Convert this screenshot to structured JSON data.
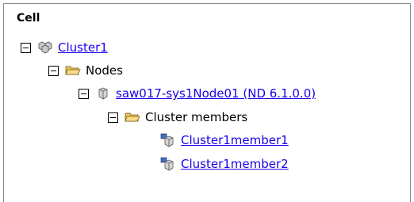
{
  "tree": {
    "root_label": "Cell",
    "cluster": {
      "label": "Cluster1",
      "icon": "cluster-icon"
    },
    "nodes": {
      "label": "Nodes",
      "icon": "folder-open-icon"
    },
    "node": {
      "label": "saw017-sys1Node01 (ND 6.1.0.0)",
      "icon": "server-node-icon"
    },
    "members_folder": {
      "label": "Cluster members",
      "icon": "folder-open-icon"
    },
    "members": [
      {
        "label": "Cluster1member1",
        "icon": "cluster-member-icon"
      },
      {
        "label": "Cluster1member2",
        "icon": "cluster-member-icon"
      }
    ]
  }
}
